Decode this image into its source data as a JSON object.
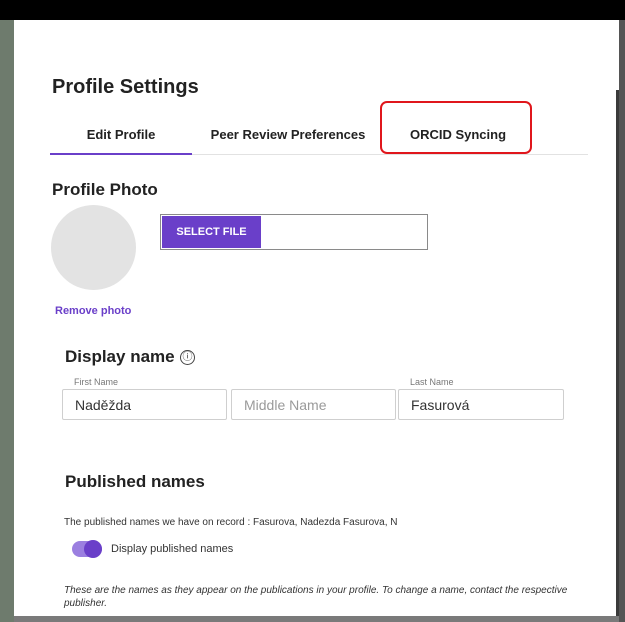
{
  "modal": {
    "title": "Profile Settings",
    "tabs": [
      {
        "label": "Edit Profile"
      },
      {
        "label": "Peer Review Preferences"
      },
      {
        "label": "ORCID Syncing"
      }
    ]
  },
  "photo": {
    "title": "Profile Photo",
    "select_label": "SELECT FILE",
    "remove_label": "Remove photo"
  },
  "display_name": {
    "title": "Display name",
    "info_icon": "ⓘ",
    "first": {
      "label": "First Name",
      "value": "Naděžda"
    },
    "middle": {
      "placeholder": "Middle Name"
    },
    "last": {
      "label": "Last Name",
      "value": "Fasurová"
    }
  },
  "published": {
    "title": "Published names",
    "record_text": "The published names we have on record :  Fasurova, Nadezda   Fasurova, N",
    "toggle_label": "Display published names",
    "toggle_on": true,
    "note": "These are the names as they appear on the publications in your profile. To change a name, contact the respective publisher."
  },
  "colors": {
    "accent": "#6a3fc9",
    "highlight": "#e0161c"
  }
}
